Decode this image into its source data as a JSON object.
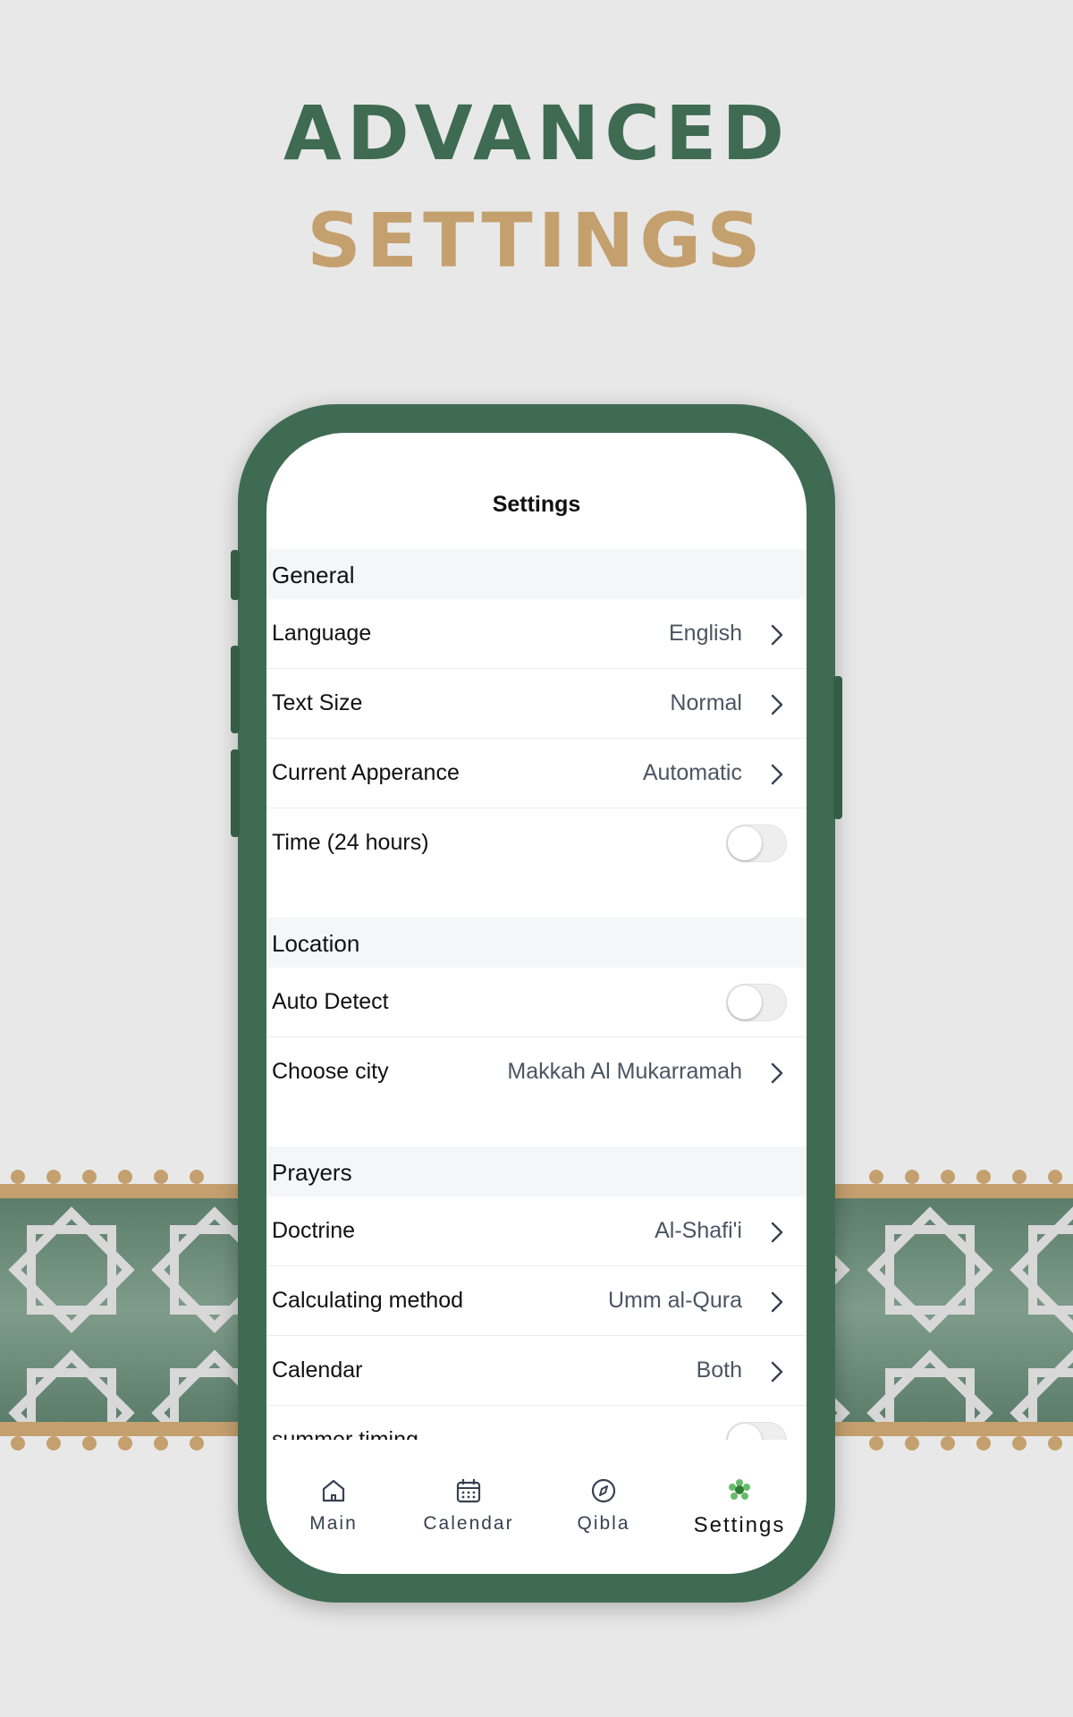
{
  "headline": {
    "line1": "ADVANCED",
    "line2": "SETTINGS"
  },
  "screen": {
    "title": "Settings",
    "sections": [
      {
        "header": "General",
        "rows": [
          {
            "label": "Language",
            "value": "English",
            "type": "nav"
          },
          {
            "label": "Text Size",
            "value": "Normal",
            "type": "nav"
          },
          {
            "label": "Current Apperance",
            "value": "Automatic",
            "type": "nav"
          },
          {
            "label": "Time (24 hours)",
            "type": "toggle",
            "on": false
          }
        ]
      },
      {
        "header": "Location",
        "rows": [
          {
            "label": "Auto Detect",
            "type": "toggle",
            "on": false
          },
          {
            "label": "Choose city",
            "value": "Makkah Al Mukarramah",
            "type": "nav"
          }
        ]
      },
      {
        "header": "Prayers",
        "rows": [
          {
            "label": "Doctrine",
            "value": "Al-Shafi'i",
            "type": "nav"
          },
          {
            "label": "Calculating method",
            "value": "Umm al-Qura",
            "type": "nav"
          },
          {
            "label": "Calendar",
            "value": "Both",
            "type": "nav"
          },
          {
            "label": "summer timing",
            "type": "toggle",
            "on": false
          }
        ]
      }
    ],
    "tabbar": [
      {
        "label": "Main",
        "icon": "home-icon",
        "active": false
      },
      {
        "label": "Calendar",
        "icon": "calendar-icon",
        "active": false
      },
      {
        "label": "Qibla",
        "icon": "compass-icon",
        "active": false
      },
      {
        "label": "Settings",
        "icon": "gear-icon",
        "active": true
      }
    ]
  },
  "colors": {
    "green": "#3f6b52",
    "gold": "#c4a06f",
    "active_icon": "#4caf50"
  }
}
